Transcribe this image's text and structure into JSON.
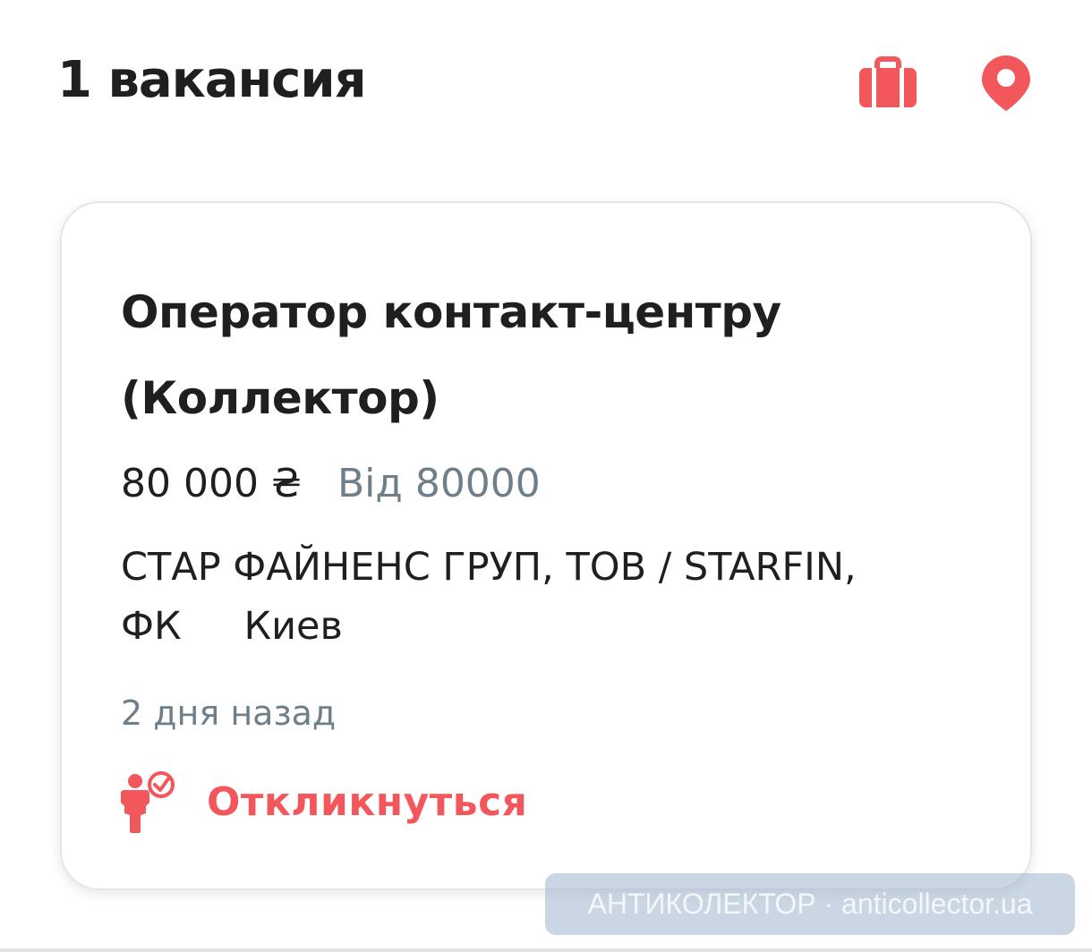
{
  "header": {
    "title": "1 вакансия",
    "briefcase_icon": "briefcase-icon",
    "location_icon": "location-pin-icon",
    "accent_color": "#f2575b"
  },
  "vacancy": {
    "title": "Оператор контакт-центру (Коллектор)",
    "salary": "80 000 ₴",
    "salary_note": "Від 80000",
    "company": "СТАР ФАЙНЕНС ГРУП, ТОВ / STARFIN, ФК",
    "city": "Киев",
    "posted": "2 дня назад",
    "apply_label": "Откликнуться",
    "apply_icon": "person-check-icon"
  },
  "watermark": {
    "text": "АНТИКОЛЕКТОР · anticollector.ua"
  }
}
